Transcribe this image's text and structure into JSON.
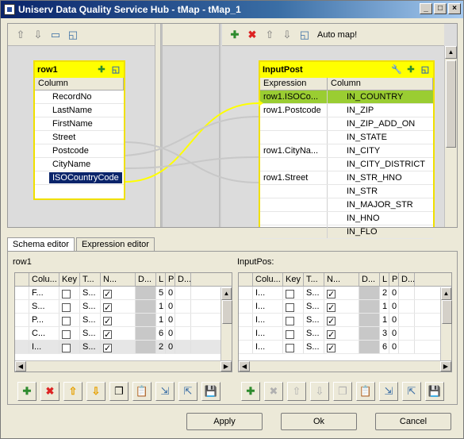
{
  "window": {
    "title": "Uniserv Data Quality Service Hub - tMap - tMap_1"
  },
  "map": {
    "left_toolbar": {
      "icons": [
        "arrow-up-icon",
        "arrow-down-icon",
        "table-icon",
        "window-icon"
      ]
    },
    "right_toolbar": {
      "automap_label": "Auto map!"
    },
    "input_box": {
      "title": "row1",
      "column_header": "Column",
      "rows": [
        "RecordNo",
        "LastName",
        "FirstName",
        "Street",
        "Postcode",
        "CityName",
        "ISOCountryCode"
      ]
    },
    "output_box": {
      "title": "InputPost",
      "header_expression": "Expression",
      "header_column": "Column",
      "rows": [
        {
          "expr": "row1.ISOCo...",
          "col": "IN_COUNTRY"
        },
        {
          "expr": "row1.Postcode",
          "col": "IN_ZIP"
        },
        {
          "expr": "",
          "col": "IN_ZIP_ADD_ON"
        },
        {
          "expr": "",
          "col": "IN_STATE"
        },
        {
          "expr": "row1.CityNa...",
          "col": "IN_CITY"
        },
        {
          "expr": "",
          "col": "IN_CITY_DISTRICT"
        },
        {
          "expr": "row1.Street",
          "col": "IN_STR_HNO"
        },
        {
          "expr": "",
          "col": "IN_STR"
        },
        {
          "expr": "",
          "col": "IN_MAJOR_STR"
        },
        {
          "expr": "",
          "col": "IN_HNO"
        },
        {
          "expr": "",
          "col": "IN_FLO"
        }
      ]
    }
  },
  "tabs": [
    "Schema editor",
    "Expression editor"
  ],
  "schema": {
    "left": {
      "label": "row1",
      "headers": [
        "",
        "Colu...",
        "Key",
        "T...",
        "N...",
        "D...",
        "L",
        "P",
        "D..."
      ],
      "rows": [
        {
          "col": "F...",
          "type": "S...",
          "l": "5",
          "p": "0"
        },
        {
          "col": "S...",
          "type": "S...",
          "l": "1",
          "p": "0"
        },
        {
          "col": "P...",
          "type": "S...",
          "l": "1",
          "p": "0"
        },
        {
          "col": "C...",
          "type": "S...",
          "l": "6",
          "p": "0"
        },
        {
          "col": "I...",
          "type": "S...",
          "l": "2",
          "p": "0"
        }
      ]
    },
    "right": {
      "label": "InputPos:",
      "headers": [
        "",
        "Colu...",
        "Key",
        "T...",
        "N...",
        "D...",
        "L",
        "P",
        "D..."
      ],
      "rows": [
        {
          "col": "I...",
          "type": "S...",
          "l": "2",
          "p": "0"
        },
        {
          "col": "I...",
          "type": "S...",
          "l": "1",
          "p": "0"
        },
        {
          "col": "I...",
          "type": "S...",
          "l": "1",
          "p": "0"
        },
        {
          "col": "I...",
          "type": "S...",
          "l": "3",
          "p": "0"
        },
        {
          "col": "I...",
          "type": "S...",
          "l": "6",
          "p": "0"
        }
      ]
    }
  },
  "buttons": {
    "apply": "Apply",
    "ok": "Ok",
    "cancel": "Cancel"
  }
}
